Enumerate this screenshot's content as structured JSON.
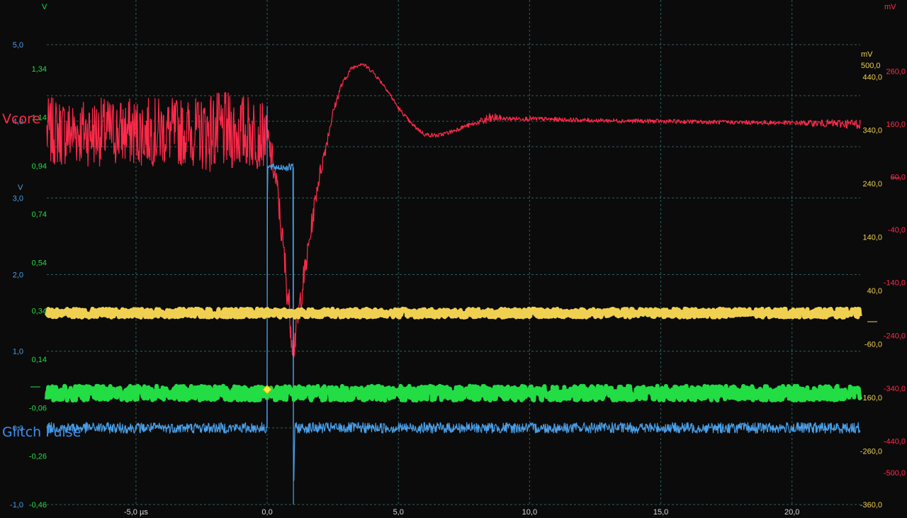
{
  "colors": {
    "background": "#0b0b0b",
    "grid": "#2f5f5f",
    "vcore": "#ff2a4a",
    "glitch": "#4a9fe8",
    "yellow": "#f0d050",
    "green": "#22dd44",
    "axis_text": "#d8d8d8"
  },
  "labels": {
    "vcore": "Vcore",
    "glitch": "Glitch Pulse"
  },
  "chart_data": {
    "type": "line",
    "title": "",
    "x_axis": {
      "unit": "µs",
      "range": [
        -8.4,
        22.6
      ],
      "ticks": [
        {
          "value": -5,
          "label": "-5,0 µs"
        },
        {
          "value": 0,
          "label": "0,0"
        },
        {
          "value": 5,
          "label": "5,0"
        },
        {
          "value": 10,
          "label": "10,0"
        },
        {
          "value": 15,
          "label": "15,0"
        },
        {
          "value": 20,
          "label": "20,0"
        }
      ]
    },
    "grid": true,
    "axes": {
      "blue_v": {
        "unit": "V",
        "color": "#4a9fe8",
        "range": [
          -1.0,
          5.0
        ],
        "ticks": [
          [
            "5,0",
            5
          ],
          [
            "4,0",
            4
          ],
          [
            "3,0",
            3
          ],
          [
            "2,0",
            2
          ],
          [
            "1,0",
            1
          ],
          [
            "0,0",
            0
          ],
          [
            "-1,0",
            -1
          ]
        ]
      },
      "green_v": {
        "unit": "V",
        "color": "#22dd44",
        "range": [
          -0.46,
          1.44
        ],
        "ticks": [
          [
            "1,34",
            1.34
          ],
          [
            "1,14",
            1.14
          ],
          [
            "0,94",
            0.94
          ],
          [
            "0,74",
            0.74
          ],
          [
            "0,54",
            0.54
          ],
          [
            "0,34",
            0.34
          ],
          [
            "0,14",
            0.14
          ],
          [
            "-0,06",
            -0.06
          ],
          [
            "-0,26",
            -0.26
          ],
          [
            "-0,46",
            -0.46
          ]
        ]
      },
      "yellow_mv": {
        "unit": "mV",
        "unit_label": "500,0",
        "color": "#f0d050",
        "range": [
          -360,
          500
        ],
        "ticks": [
          [
            "440,0",
            440
          ],
          [
            "340,0",
            340
          ],
          [
            "240,0",
            240
          ],
          [
            "140,0",
            140
          ],
          [
            "40,0",
            40
          ],
          [
            "-60,0",
            -60
          ],
          [
            "-160,0",
            -160
          ],
          [
            "-260,0",
            -260
          ],
          [
            "-360,0",
            -360
          ]
        ]
      },
      "red_mv": {
        "unit": "mV",
        "color": "#ff2a4a",
        "range": [
          -560,
          310
        ],
        "ticks": [
          [
            "260,0",
            260
          ],
          [
            "160,0",
            160
          ],
          [
            "60,0",
            60
          ],
          [
            "-40,0",
            -40
          ],
          [
            "-140,0",
            -140
          ],
          [
            "-240,0",
            -240
          ],
          [
            "-340,0",
            -340
          ],
          [
            "-440,0",
            -440
          ],
          [
            "-500,0",
            -500
          ]
        ]
      }
    },
    "series": [
      {
        "name": "Vcore",
        "axis": "red_mv",
        "x": [
          -8.4,
          -4,
          -2.5,
          -2.45,
          -0.3,
          0,
          0.2,
          0.4,
          0.6,
          0.8,
          1.0,
          1.1,
          1.2,
          1.3,
          1.5,
          1.7,
          1.9,
          2.2,
          2.5,
          2.8,
          3.2,
          3.6,
          4.0,
          4.5,
          5.0,
          5.5,
          6.0,
          6.5,
          7.0,
          7.5,
          8.0,
          8.4,
          8.7,
          9.0,
          10,
          12,
          15,
          18,
          20,
          22.6
        ],
        "y": [
          145,
          145,
          145,
          145,
          145,
          130,
          90,
          30,
          -70,
          -170,
          -260,
          -230,
          -200,
          -160,
          -100,
          -30,
          40,
          110,
          180,
          230,
          265,
          275,
          260,
          230,
          190,
          160,
          140,
          138,
          145,
          155,
          162,
          168,
          172,
          170,
          170,
          167,
          165,
          163,
          162,
          160
        ],
        "noise": [
          65,
          65,
          65,
          78,
          70,
          45,
          30,
          30,
          35,
          40,
          40,
          35,
          30,
          30,
          25,
          22,
          18,
          15,
          8,
          6,
          4,
          4,
          4,
          4,
          4,
          4,
          4,
          4,
          4,
          4,
          4,
          12,
          8,
          4,
          4,
          4,
          4,
          4,
          4,
          10
        ]
      },
      {
        "name": "Glitch Pulse",
        "axis": "blue_v",
        "x": [
          -8.4,
          0.0,
          0.01,
          0.05,
          0.98,
          1.0,
          1.05,
          22.6
        ],
        "y": [
          0.0,
          0.0,
          3.4,
          3.4,
          3.4,
          -1.0,
          0.0,
          0.0
        ],
        "noise": [
          0.07,
          0.07,
          0,
          0.05,
          0.05,
          0,
          0.07,
          0.07
        ],
        "spike": {
          "x": 0.0,
          "y": 4.2
        }
      },
      {
        "name": "",
        "axis": "yellow_mv",
        "x": [
          -8.4,
          22.6
        ],
        "y": [
          -2,
          -2
        ],
        "noise": [
          8,
          8
        ]
      },
      {
        "name": "",
        "axis": "green_v",
        "x": [
          -8.4,
          22.6
        ],
        "y": [
          -0.0,
          -0.0
        ],
        "noise": [
          0.03,
          0.03
        ]
      }
    ],
    "trigger": {
      "x": 0.0,
      "y_blue": 0.5,
      "marker": "diamond"
    }
  }
}
